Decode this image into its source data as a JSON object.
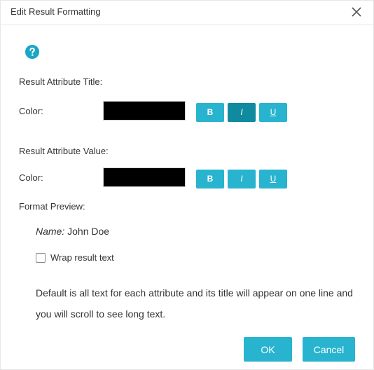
{
  "dialog": {
    "title": "Edit Result Formatting"
  },
  "icons": {
    "close": "close-icon",
    "help": "help-icon"
  },
  "attribute_title": {
    "heading": "Result Attribute Title:",
    "color_label": "Color:",
    "color_value": "#000000",
    "bold_label": "B",
    "italic_label": "I",
    "underline_label": "U",
    "italic_active": true
  },
  "attribute_value": {
    "heading": "Result Attribute Value:",
    "color_label": "Color:",
    "color_value": "#000000",
    "bold_label": "B",
    "italic_label": "I",
    "underline_label": "U"
  },
  "preview": {
    "heading": "Format Preview:",
    "name": "Name:",
    "value": "John Doe"
  },
  "wrap": {
    "label": "Wrap result text",
    "checked": false
  },
  "description": "Default is all text for each attribute and its title will appear on one line and you will scroll to see long text.",
  "footer": {
    "ok_label": "OK",
    "cancel_label": "Cancel"
  },
  "colors": {
    "accent": "#28b4cf",
    "accent_active": "#0f8a9e",
    "help_icon": "#1aa5c4"
  }
}
